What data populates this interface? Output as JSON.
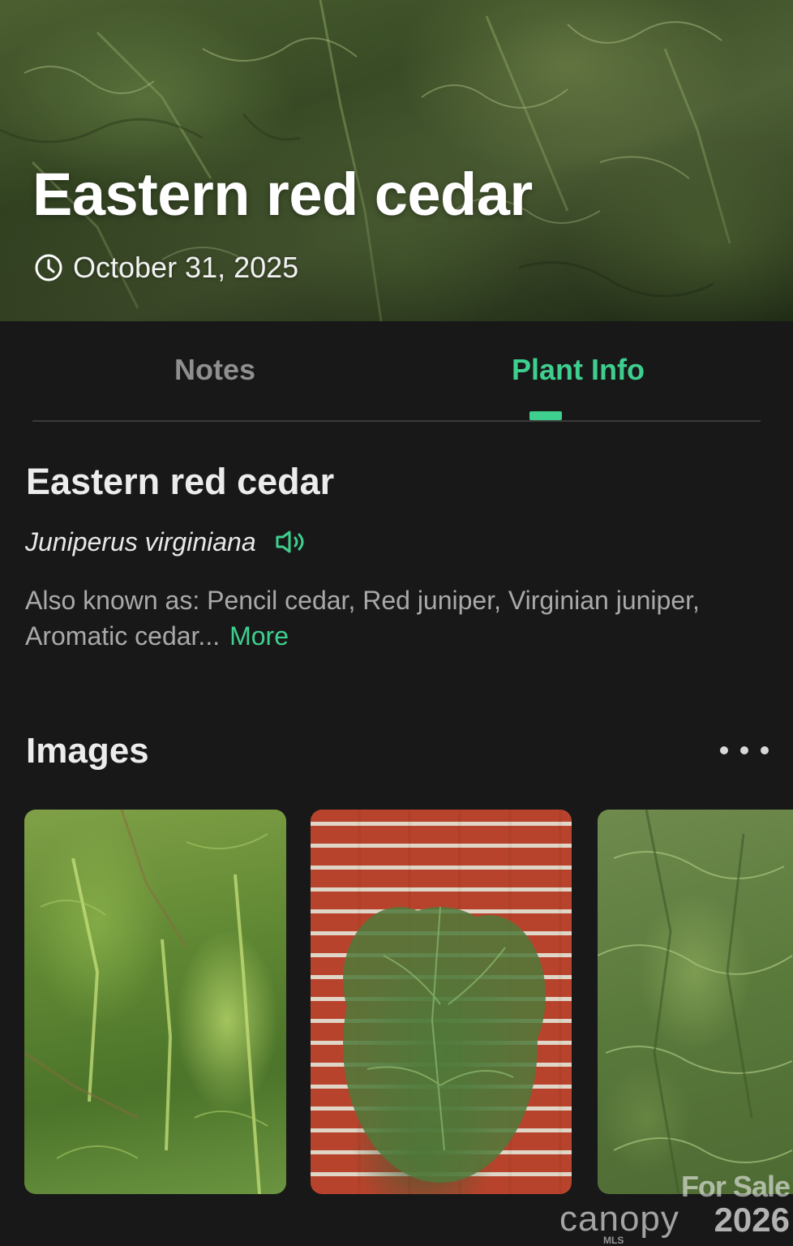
{
  "hero": {
    "title": "Eastern red cedar",
    "date": "October 31, 2025",
    "date_icon": "clock-icon"
  },
  "tabs": [
    {
      "label": "Notes",
      "active": false
    },
    {
      "label": "Plant Info",
      "active": true
    }
  ],
  "plant": {
    "name": "Eastern red cedar",
    "scientific_name": "Juniperus virginiana",
    "pronounce_icon": "speaker-icon",
    "also_known_as": "Also known as: Pencil cedar, Red juniper, Virginian juniper, Aromatic cedar...",
    "more_label": "More"
  },
  "images": {
    "title": "Images",
    "menu_icon": "more-horizontal-icon",
    "items": [
      "juniper-foliage-closeup",
      "juniper-against-brick-wall",
      "juniper-shrub-foliage"
    ]
  },
  "watermark": {
    "top": "For Sale",
    "brand": "canopy",
    "sub": "MLS",
    "year": "2026"
  },
  "colors": {
    "accent": "#3ecf8e",
    "background": "#181818",
    "muted_text": "#a9a9a9"
  }
}
